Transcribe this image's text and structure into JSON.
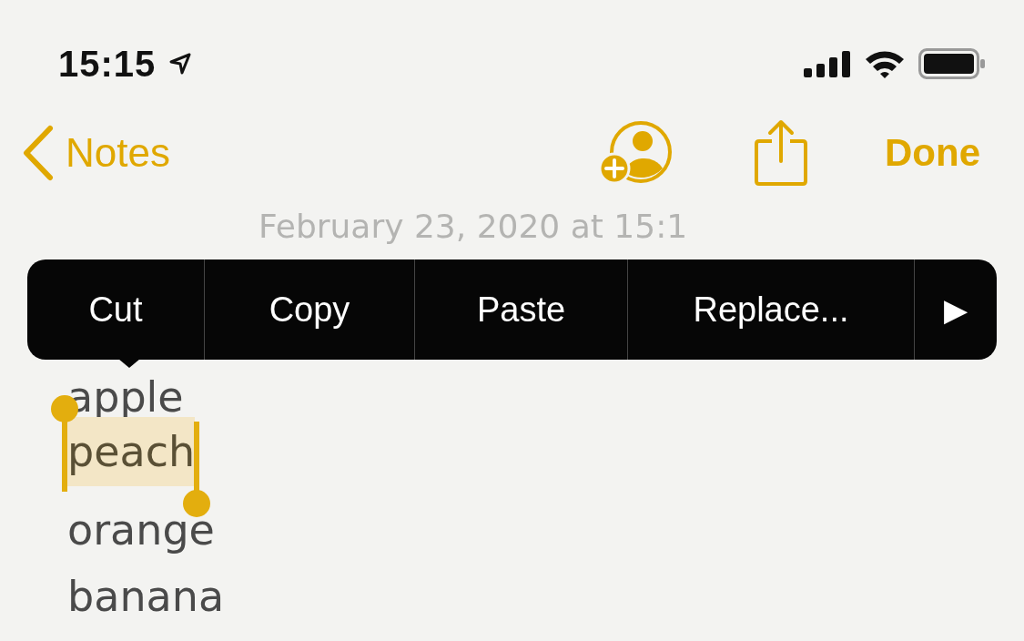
{
  "status_bar": {
    "time": "15:15"
  },
  "nav": {
    "back_label": "Notes",
    "done_label": "Done"
  },
  "note": {
    "date": "February 23, 2020 at 15:1",
    "lines": [
      {
        "text": "apple",
        "selected": false
      },
      {
        "text": "peach",
        "selected": true
      },
      {
        "text": "orange",
        "selected": false
      },
      {
        "text": "banana",
        "selected": false
      }
    ]
  },
  "edit_menu": {
    "items": [
      {
        "kind": "text",
        "label": "Cut"
      },
      {
        "kind": "text",
        "label": "Copy"
      },
      {
        "kind": "text",
        "label": "Paste"
      },
      {
        "kind": "text",
        "label": "Replace..."
      },
      {
        "kind": "arrow",
        "label": "▶"
      }
    ]
  }
}
